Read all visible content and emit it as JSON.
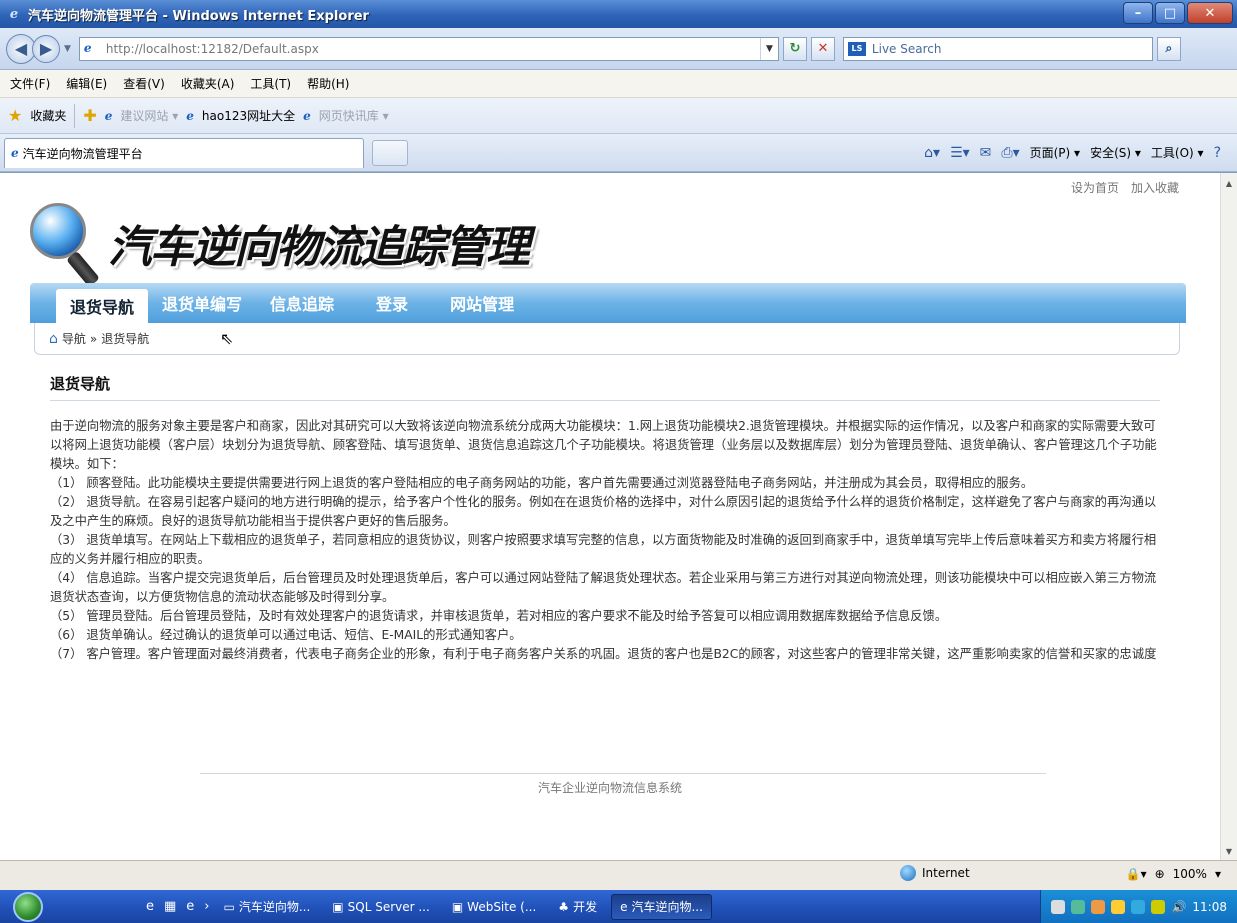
{
  "window": {
    "title": "汽车逆向物流管理平台 - Windows Internet Explorer",
    "min": "–",
    "max": "□",
    "close": "✕"
  },
  "addressbar": {
    "url": "http://localhost:12182/Default.aspx",
    "search_placeholder": "Live Search"
  },
  "menu": [
    "文件(F)",
    "编辑(E)",
    "查看(V)",
    "收藏夹(A)",
    "工具(T)",
    "帮助(H)"
  ],
  "favorites": {
    "label": "收藏夹",
    "items": [
      "建议网站 ▾",
      "hao123网址大全",
      "网页快讯库 ▾"
    ]
  },
  "tab": {
    "title": "汽车逆向物流管理平台"
  },
  "toolbar": {
    "page": "页面(P) ▾",
    "safety": "安全(S) ▾",
    "tools": "工具(O) ▾",
    "help": "?"
  },
  "page": {
    "toplinks": [
      "设为首页",
      "加入收藏"
    ],
    "logo_text": "汽车逆向物流追踪管理",
    "nav": [
      "退货导航",
      "退货单编写",
      "信息追踪",
      "登录",
      "网站管理"
    ],
    "breadcrumb": {
      "home": "导航",
      "sep": "»",
      "current": "退货导航"
    },
    "section_title": "退货导航",
    "paragraphs": [
      "由于逆向物流的服务对象主要是客户和商家，因此对其研究可以大致将该逆向物流系统分成两大功能模块：1.网上退货功能模块2.退货管理模块。并根据实际的运作情况，以及客户和商家的实际需要大致可以将网上退货功能模（客户层）块划分为退货导航、顾客登陆、填写退货单、退货信息追踪这几个子功能模块。将退货管理（业务层以及数据库层）划分为管理员登陆、退货单确认、客户管理这几个子功能模块。如下：",
      "（1） 顾客登陆。此功能模块主要提供需要进行网上退货的客户登陆相应的电子商务网站的功能，客户首先需要通过浏览器登陆电子商务网站，并注册成为其会员，取得相应的服务。",
      "（2） 退货导航。在容易引起客户疑问的地方进行明确的提示，给予客户个性化的服务。例如在在退货价格的选择中，对什么原因引起的退货给予什么样的退货价格制定，这样避免了客户与商家的再沟通以及之中产生的麻烦。良好的退货导航功能相当于提供客户更好的售后服务。",
      "（3） 退货单填写。在网站上下载相应的退货单子，若同意相应的退货协议，则客户按照要求填写完整的信息，以方面货物能及时准确的返回到商家手中，退货单填写完毕上传后意味着买方和卖方将履行相应的义务并履行相应的职责。",
      "（4） 信息追踪。当客户提交完退货单后，后台管理员及时处理退货单后，客户可以通过网站登陆了解退货处理状态。若企业采用与第三方进行对其逆向物流处理，则该功能模块中可以相应嵌入第三方物流退货状态查询，以方便货物信息的流动状态能够及时得到分享。",
      "（5） 管理员登陆。后台管理员登陆，及时有效处理客户的退货请求，并审核退货单，若对相应的客户要求不能及时给予答复可以相应调用数据库数据给予信息反馈。",
      "（6） 退货单确认。经过确认的退货单可以通过电话、短信、E-MAIL的形式通知客户。",
      "（7） 客户管理。客户管理面对最终消费者，代表电子商务企业的形象，有利于电子商务客户关系的巩固。退货的客户也是B2C的顾客，对这些客户的管理非常关键，这严重影响卖家的信誉和买家的忠诚度"
    ],
    "footer": "汽车企业逆向物流信息系统"
  },
  "statusbar": {
    "zone": "Internet",
    "zoom": "100%"
  },
  "taskbar": {
    "items": [
      "汽车逆向物...",
      "SQL Server ...",
      "WebSite (...",
      "开发",
      "汽车逆向物..."
    ],
    "clock": "11:08"
  }
}
